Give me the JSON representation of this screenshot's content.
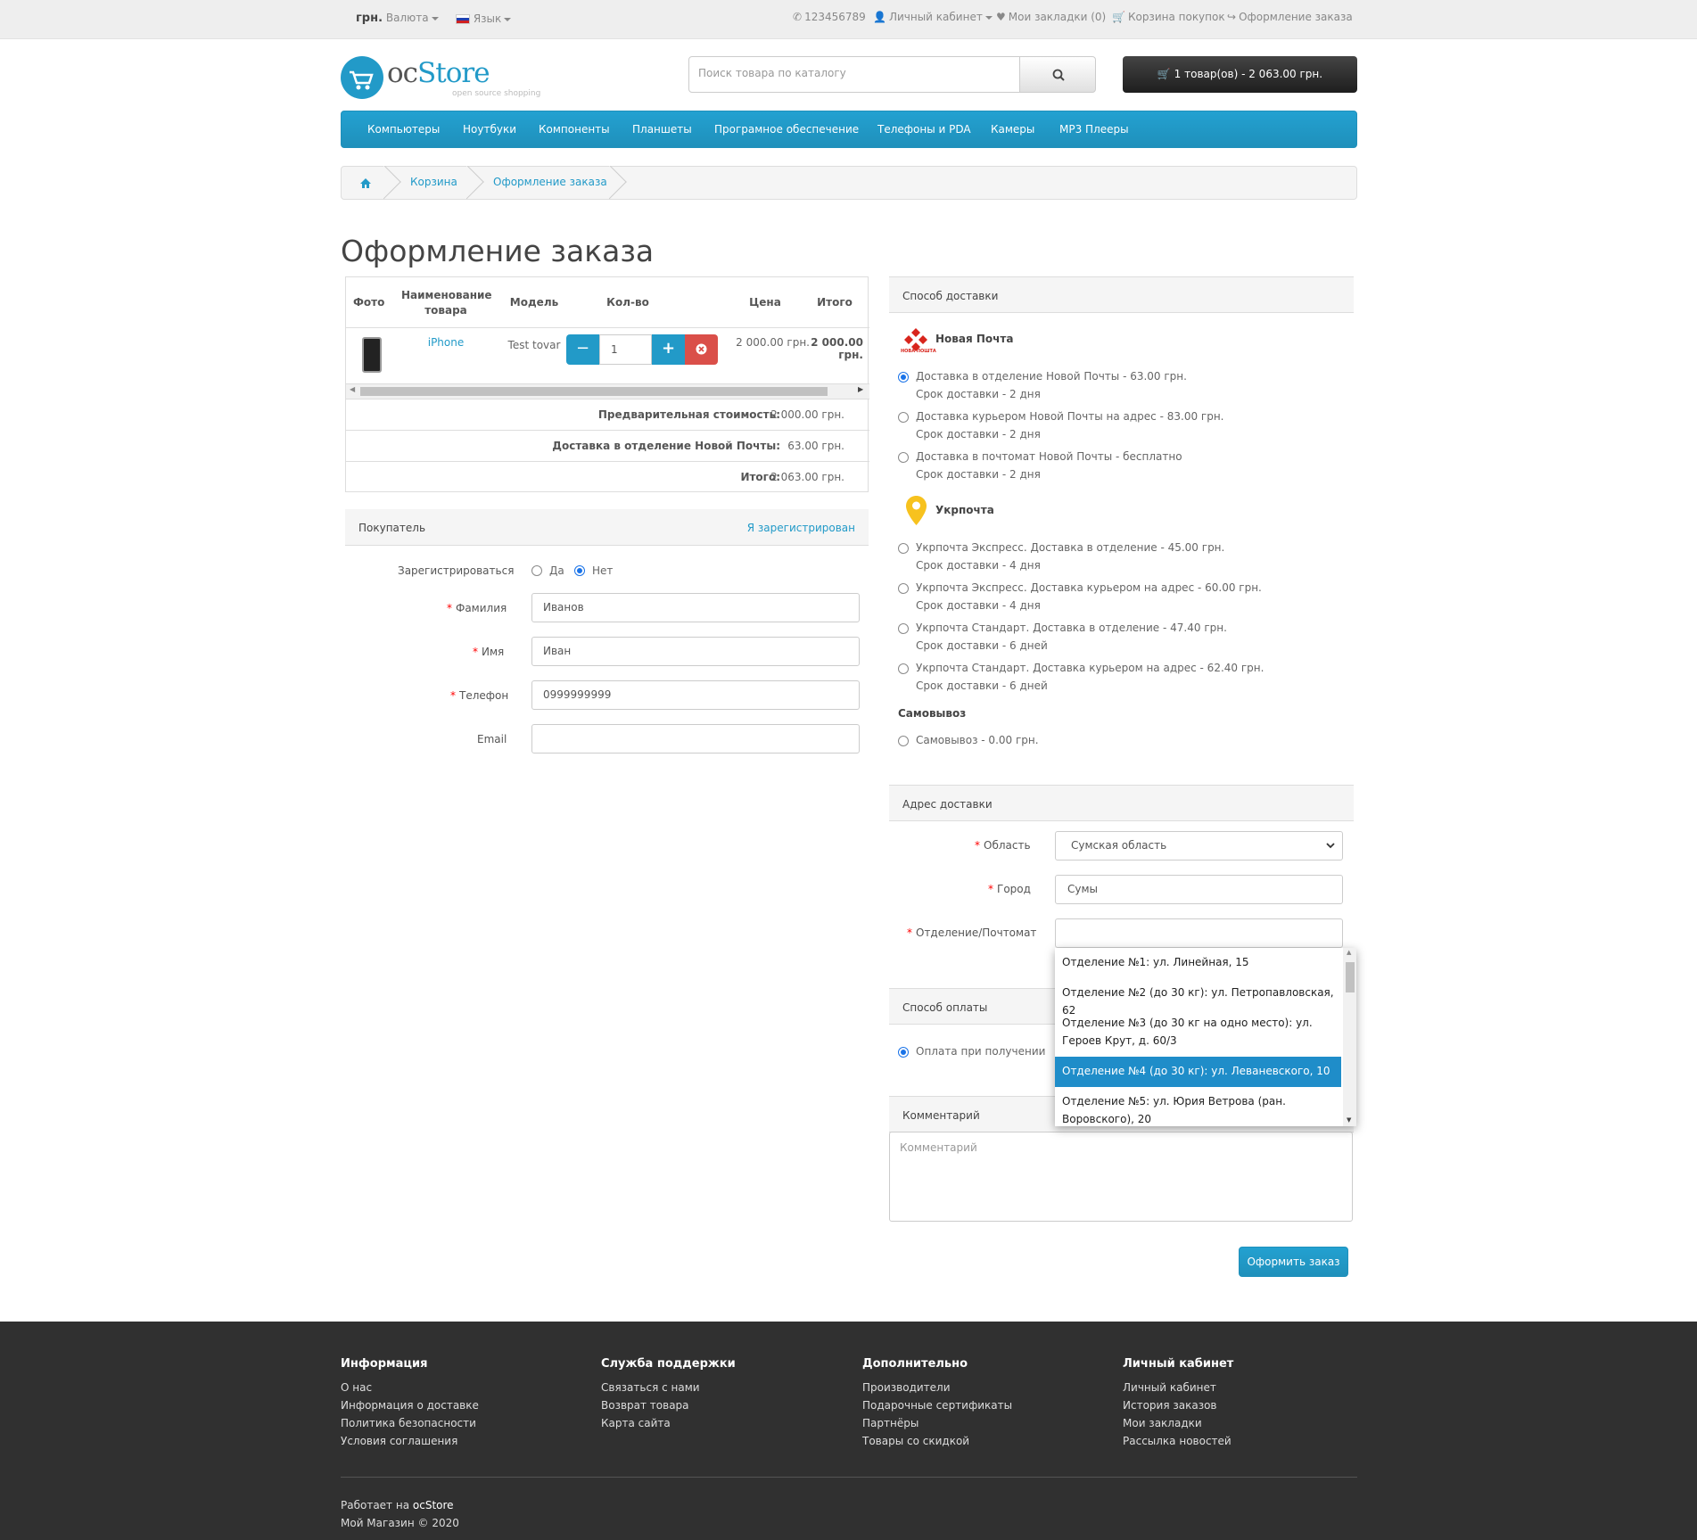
{
  "topbar": {
    "currency_symbol": "грн.",
    "currency_label": "Валюта",
    "language_label": "Язык",
    "phone": "123456789",
    "account": "Личный кабинет",
    "wishlist": "Мои закладки (0)",
    "cart": "Корзина покупок",
    "checkout": "Оформление заказа"
  },
  "logo": {
    "text": "ocStore",
    "tagline": "open source shopping"
  },
  "search": {
    "placeholder": "Поиск товара по каталогу"
  },
  "cart_button": "1 товар(ов) - 2 063.00 грн.",
  "menu": [
    "Компьютеры",
    "Ноутбуки",
    "Компоненты",
    "Планшеты",
    "Програмное обеспечение",
    "Телефоны и PDA",
    "Камеры",
    "MP3 Плееры"
  ],
  "breadcrumb": [
    "Корзина",
    "Оформление заказа"
  ],
  "page_title": "Оформление заказа",
  "cart_table": {
    "headers": {
      "photo": "Фото",
      "name": "Наименование товара",
      "model": "Модель",
      "qty": "Кол-во",
      "price": "Цена",
      "total": "Итого"
    },
    "row": {
      "name": "iPhone",
      "model": "Test tovar",
      "qty": "1",
      "price": "2 000.00 грн.",
      "total": "2 000.00 грн."
    },
    "totals": [
      {
        "label": "Предварительная стоимость:",
        "value": "2 000.00 грн."
      },
      {
        "label": "Доставка в отделение Новой Почты:",
        "value": "63.00 грн."
      },
      {
        "label": "Итого:",
        "value": "2 063.00 грн."
      }
    ]
  },
  "customer": {
    "title": "Покупатель",
    "login_link": "Я зарегистрирован",
    "register_label": "Зарегистрироваться",
    "register_yes": "Да",
    "register_no": "Нет",
    "register_selected": "Нет",
    "lastname_label": "Фамилия",
    "lastname": "Иванов",
    "firstname_label": "Имя",
    "firstname": "Иван",
    "phone_label": "Телефон",
    "phone": "0999999999",
    "email_label": "Email",
    "email": ""
  },
  "shipping": {
    "title": "Способ доставки",
    "np_title": "Новая Почта",
    "np_logo_text": "НОВА ПОШТА",
    "np_options": [
      {
        "label": "Доставка в отделение Новой Почты - 63.00 грн.",
        "term": "Срок доставки - 2 дня",
        "selected": true
      },
      {
        "label": "Доставка курьером Новой Почты на адрес - 83.00 грн.",
        "term": "Срок доставки - 2 дня",
        "selected": false
      },
      {
        "label": "Доставка в почтомат Новой Почты - бесплатно",
        "term": "Срок доставки - 2 дня",
        "selected": false
      }
    ],
    "up_title": "Укрпочта",
    "up_options": [
      {
        "label": "Укрпочта Экспресс. Доставка в отделение - 45.00 грн.",
        "term": "Срок доставки - 4 дня"
      },
      {
        "label": "Укрпочта Экспресс. Доставка курьером на адрес - 60.00 грн.",
        "term": "Срок доставки - 4 дня"
      },
      {
        "label": "Укрпочта Стандарт. Доставка в отделение - 47.40 грн.",
        "term": "Срок доставки - 6 дней"
      },
      {
        "label": "Укрпочта Стандарт. Доставка курьером на адрес - 62.40 грн.",
        "term": "Срок доставки - 6 дней"
      }
    ],
    "pickup_title": "Самовывоз",
    "pickup_option": "Самовывоз - 0.00 грн."
  },
  "address": {
    "title": "Адрес доставки",
    "region_label": "Область",
    "region": "Сумская область",
    "city_label": "Город",
    "city": "Сумы",
    "branch_label": "Отделение/Почтомат",
    "branch": "",
    "dropdown": [
      {
        "text": "Отделение №1: ул. Линейная, 15",
        "selected": false
      },
      {
        "text": "Отделение №2 (до 30 кг): ул. Петропавловская, 62",
        "selected": false
      },
      {
        "text": "Отделение №3 (до 30 кг на одно место): ул. Героев Крут, д. 60/3",
        "selected": false
      },
      {
        "text": "Отделение №4 (до 30 кг): ул. Леваневского, 10",
        "selected": true
      },
      {
        "text": "Отделение №5: ул. Юрия Ветрова (ран. Воровского), 20",
        "selected": false
      }
    ]
  },
  "payment": {
    "title": "Способ оплаты",
    "option": "Оплата при получении"
  },
  "comment": {
    "title": "Комментарий",
    "placeholder": "Комментарий"
  },
  "submit_button": "Оформить заказ",
  "footer": {
    "columns": [
      {
        "title": "Информация",
        "links": [
          "О нас",
          "Информация о доставке",
          "Политика безопасности",
          "Условия соглашения"
        ]
      },
      {
        "title": "Служба поддержки",
        "links": [
          "Связаться с нами",
          "Возврат товара",
          "Карта сайта"
        ]
      },
      {
        "title": "Дополнительно",
        "links": [
          "Производители",
          "Подарочные сертификаты",
          "Партнёры",
          "Товары со скидкой"
        ]
      },
      {
        "title": "Личный кабинет",
        "links": [
          "Личный кабинет",
          "История заказов",
          "Мои закладки",
          "Рассылка новостей"
        ]
      }
    ],
    "powered_prefix": "Работает на ",
    "powered_link": "ocStore",
    "copyright": "Мой Магазин © 2020"
  },
  "colors": {
    "accent": "#229ac8",
    "danger": "#da4f49",
    "nav": "#229ac8"
  }
}
